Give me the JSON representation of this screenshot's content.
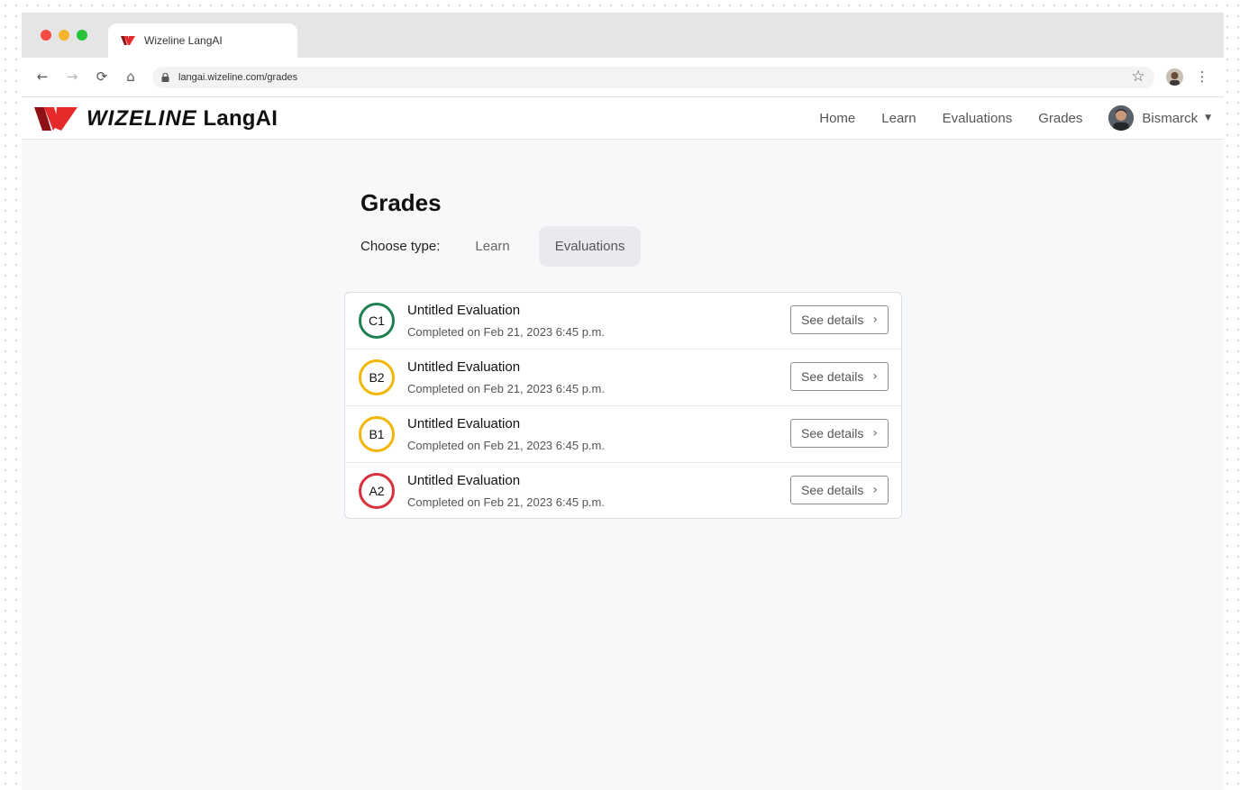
{
  "browser": {
    "tab_title": "Wizeline LangAI",
    "url": "langai.wizeline.com/grades",
    "back_icon": "←",
    "forward_icon": "→",
    "reload_icon": "⟳",
    "home_icon": "⌂",
    "star_icon": "☆",
    "menu_icon": "⋮"
  },
  "header": {
    "brand_bold": "WIZELINE",
    "brand_light": "LangAI",
    "nav": [
      "Home",
      "Learn",
      "Evaluations",
      "Grades"
    ],
    "user_name": "Bismarck",
    "caret": "▼"
  },
  "main": {
    "title": "Grades",
    "choose_type_label": "Choose type:",
    "type_tabs": [
      "Learn",
      "Evaluations"
    ],
    "active_tab": "Evaluations",
    "items": [
      {
        "grade": "C1",
        "color": "#1e7f4f",
        "title": "Untitled Evaluation",
        "subtitle": "Completed on Feb 21, 2023 6:45 p.m.",
        "button": "See details"
      },
      {
        "grade": "B2",
        "color": "#f2b705",
        "title": "Untitled Evaluation",
        "subtitle": "Completed on Feb 21, 2023 6:45 p.m.",
        "button": "See details"
      },
      {
        "grade": "B1",
        "color": "#f2b705",
        "title": "Untitled Evaluation",
        "subtitle": "Completed on Feb 21, 2023 6:45 p.m.",
        "button": "See details"
      },
      {
        "grade": "A2",
        "color": "#d9303e",
        "title": "Untitled Evaluation",
        "subtitle": "Completed on Feb 21, 2023 6:45 p.m.",
        "button": "See details"
      }
    ]
  },
  "colors": {
    "brand_red": "#e42a2a",
    "brand_dark_red": "#8f1116"
  }
}
